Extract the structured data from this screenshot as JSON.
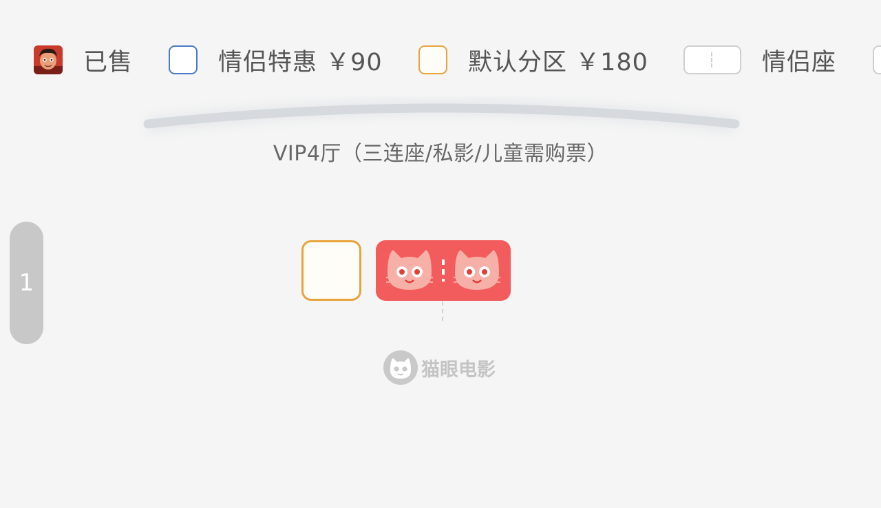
{
  "legend": {
    "sold": {
      "label": "已售",
      "icon": "avatar-icon"
    },
    "couple_discount": {
      "label": "情侣特惠 ￥90",
      "color": "#4a7bc4"
    },
    "default_zone": {
      "label": "默认分区 ￥180",
      "color": "#e8a33c"
    },
    "couple_seat": {
      "label": "情侣座",
      "color": "#cfcfcf"
    }
  },
  "screen": {
    "name": "VIP4厅（三连座/私影/儿童需购票）"
  },
  "row_indicator": {
    "label": "1"
  },
  "seats": {
    "available_color": "#e8a33c",
    "sold_color": "#f25c5c"
  },
  "watermark": {
    "text": "猫眼电影",
    "icon": "maoyan-cat-logo-icon"
  }
}
